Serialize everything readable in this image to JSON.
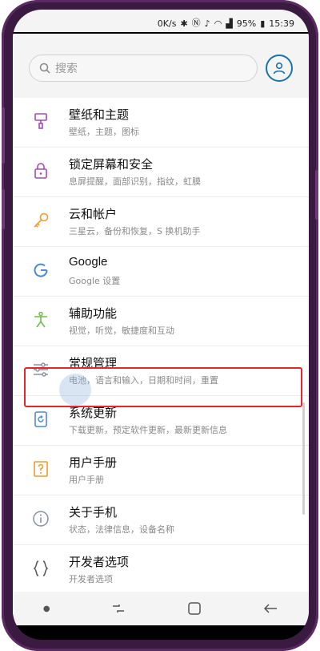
{
  "status_bar": {
    "network_speed": "0K/s",
    "battery": "95%",
    "time": "15:39"
  },
  "search": {
    "placeholder": "搜索"
  },
  "settings": [
    {
      "title": "壁纸和主题",
      "subtitle": "壁纸，主题，图标",
      "icon": "paintbrush-icon",
      "color": "#a24bb5"
    },
    {
      "title": "锁定屏幕和安全",
      "subtitle": "息屏提醒，面部识别，指纹，虹膜",
      "icon": "lock-icon",
      "color": "#a24bb5"
    },
    {
      "title": "云和帐户",
      "subtitle": "三星云，备份和恢复，S 换机助手",
      "icon": "key-icon",
      "color": "#f29a2e"
    },
    {
      "title": "Google",
      "subtitle": "Google 设置",
      "icon": "google-icon",
      "color": "#4a89dc"
    },
    {
      "title": "辅助功能",
      "subtitle": "视觉，听觉，敏捷度和互动",
      "icon": "accessibility-icon",
      "color": "#6bbf4c"
    },
    {
      "title": "常规管理",
      "subtitle": "电池，语言和输入，日期和时间，重置",
      "icon": "sliders-icon",
      "color": "#8a8fa0"
    },
    {
      "title": "系统更新",
      "subtitle": "下载更新，预定软件更新，最新更新信息",
      "icon": "update-icon",
      "color": "#4a89dc"
    },
    {
      "title": "用户手册",
      "subtitle": "用户手册",
      "icon": "manual-icon",
      "color": "#f29a2e"
    },
    {
      "title": "关于手机",
      "subtitle": "状态，法律信息，设备名称",
      "icon": "info-icon",
      "color": "#8a8fa0"
    },
    {
      "title": "开发者选项",
      "subtitle": "开发者选项",
      "icon": "braces-icon",
      "color": "#555555"
    }
  ]
}
